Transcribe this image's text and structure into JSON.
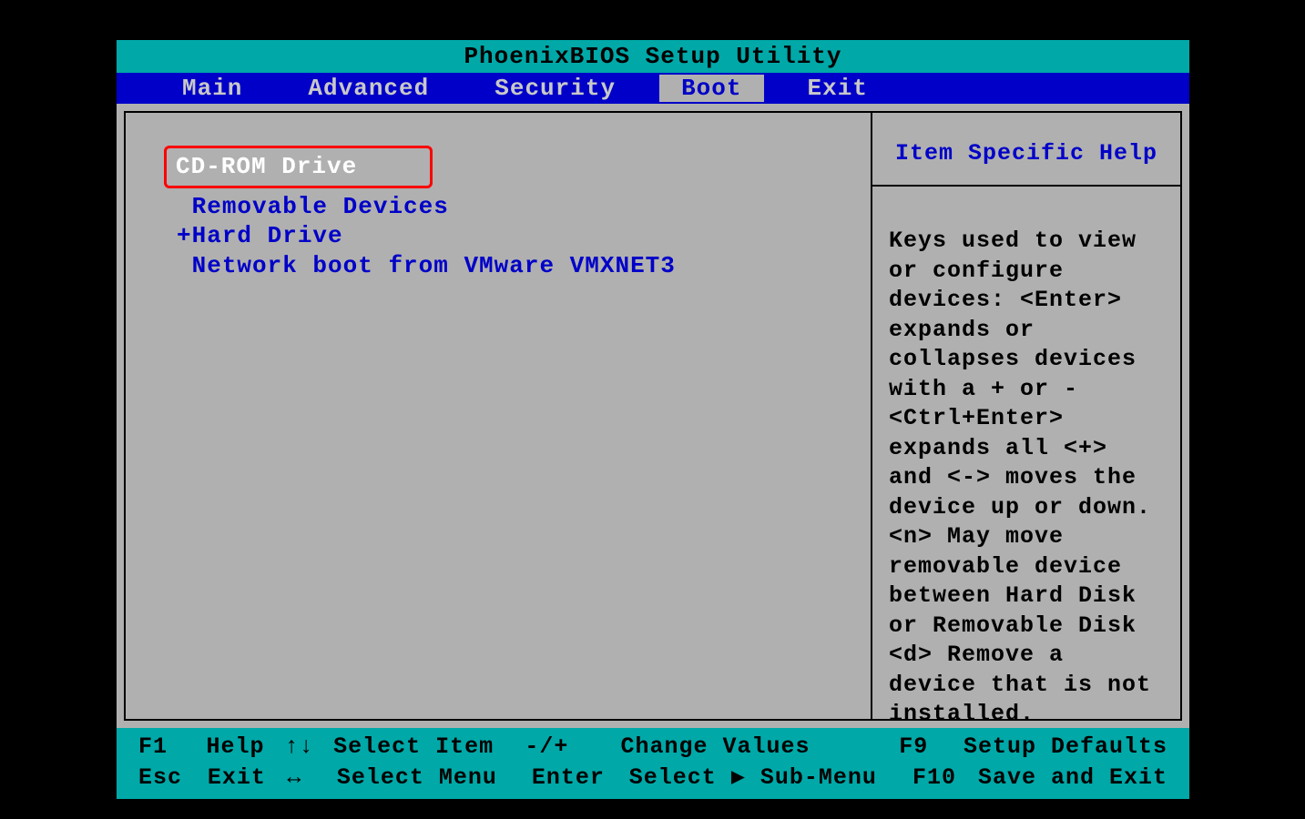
{
  "title": "PhoenixBIOS Setup Utility",
  "menu": {
    "items": [
      "Main",
      "Advanced",
      "Security",
      "Boot",
      "Exit"
    ],
    "active_index": 3
  },
  "boot_items": [
    {
      "label": "CD-ROM Drive",
      "prefix": " ",
      "selected": true
    },
    {
      "label": "Removable Devices",
      "prefix": " ",
      "selected": false
    },
    {
      "label": "Hard Drive",
      "prefix": "+",
      "selected": false
    },
    {
      "label": "Network boot from VMware VMXNET3",
      "prefix": " ",
      "selected": false
    }
  ],
  "help": {
    "header": "Item Specific Help",
    "body": "Keys used to view or configure devices:\n<Enter> expands or collapses devices with a + or -\n<Ctrl+Enter> expands all\n<+> and <-> moves the device up or down.\n<n> May move removable device between Hard Disk or Removable Disk\n<d> Remove a device that is not installed."
  },
  "footer": {
    "rows": [
      {
        "key1": "F1",
        "lbl1": "Help",
        "key2": "↑↓",
        "lbl2": "Select Item",
        "key3": "-/+",
        "lbl3": "Change Values",
        "key4": "F9",
        "lbl4": "Setup Defaults"
      },
      {
        "key1": "Esc",
        "lbl1": "Exit",
        "key2": "↔",
        "lbl2": "Select Menu",
        "key3": "Enter",
        "lbl3": "Select ▶ Sub-Menu",
        "key4": "F10",
        "lbl4": "Save and Exit"
      }
    ]
  }
}
